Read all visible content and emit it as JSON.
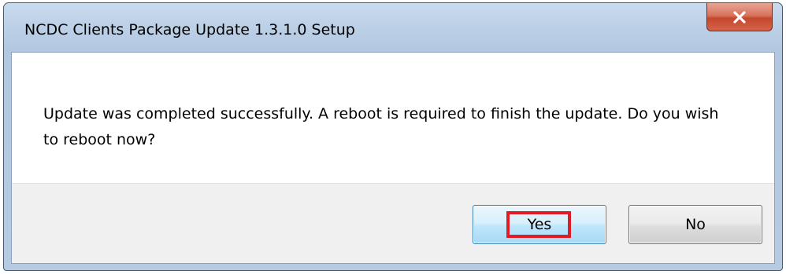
{
  "window": {
    "title": "NCDC Clients Package Update 1.3.1.0 Setup",
    "close_icon": "close-icon"
  },
  "dialog": {
    "message": "Update was completed successfully. A reboot is required to finish the update. Do you wish to reboot now?"
  },
  "buttons": {
    "yes_label": "Yes",
    "no_label": "No"
  },
  "colors": {
    "highlight": "#e01b24",
    "close_button": "#c4482d"
  }
}
